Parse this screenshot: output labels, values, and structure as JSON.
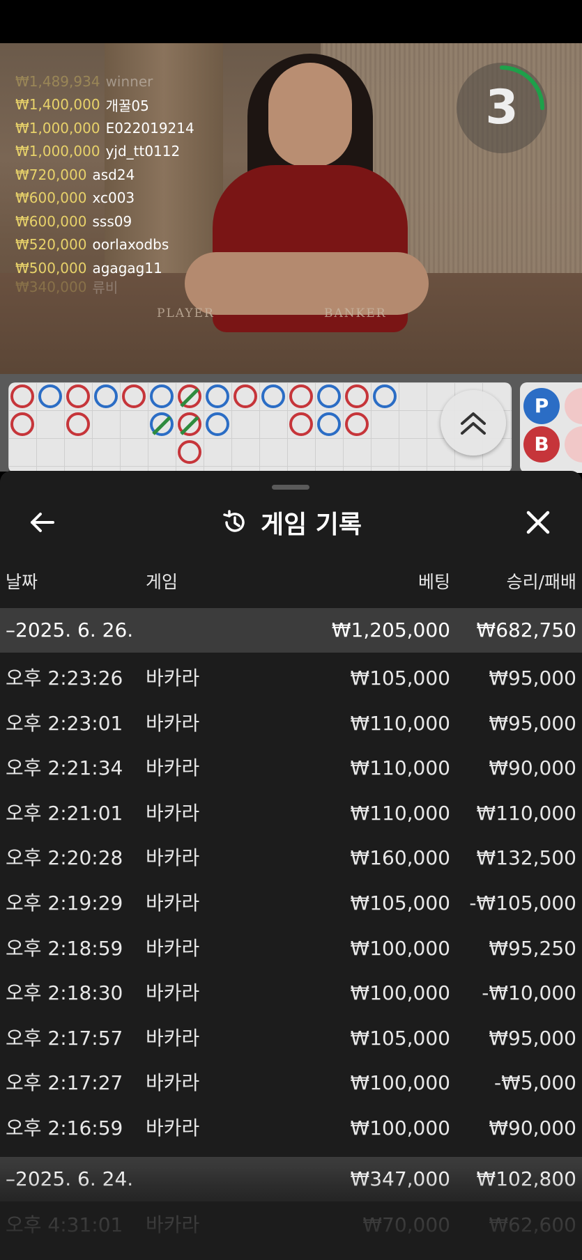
{
  "winners": [
    {
      "amount": "₩1,489,934",
      "name": "winner"
    },
    {
      "amount": "₩1,400,000",
      "name": "개꿀05"
    },
    {
      "amount": "₩1,000,000",
      "name": "E022019214"
    },
    {
      "amount": "₩1,000,000",
      "name": "yjd_tt0112"
    },
    {
      "amount": "₩720,000",
      "name": "asd24"
    },
    {
      "amount": "₩600,000",
      "name": "xc003"
    },
    {
      "amount": "₩600,000",
      "name": "sss09"
    },
    {
      "amount": "₩520,000",
      "name": "oorlaxodbs"
    },
    {
      "amount": "₩500,000",
      "name": "agagag11"
    },
    {
      "amount": "₩340,000",
      "name": "류비"
    }
  ],
  "table_labels": {
    "player": "PLAYER",
    "banker": "BANKER"
  },
  "timer": {
    "value": "3",
    "progress": 0.25
  },
  "road_buttons": {
    "player": "P",
    "banker": "B"
  },
  "colors": {
    "player": "#2b6dc5",
    "banker": "#c6353a",
    "tie": "#2e8b3e",
    "gold": "#e8d26a"
  },
  "sheet": {
    "title": "게임 기록",
    "back_icon": "arrow-left-icon",
    "history_icon": "history-clock-icon",
    "close_icon": "close-icon",
    "columns": {
      "date": "날짜",
      "game": "게임",
      "bet": "베팅",
      "win": "승리/패배"
    },
    "groups": [
      {
        "date": "–2025. 6. 26.",
        "bet": "₩1,205,000",
        "win": "₩682,750",
        "rows": [
          {
            "time": "오후 2:23:26",
            "game": "바카라",
            "bet": "₩105,000",
            "win": "₩95,000"
          },
          {
            "time": "오후 2:23:01",
            "game": "바카라",
            "bet": "₩110,000",
            "win": "₩95,000"
          },
          {
            "time": "오후 2:21:34",
            "game": "바카라",
            "bet": "₩110,000",
            "win": "₩90,000"
          },
          {
            "time": "오후 2:21:01",
            "game": "바카라",
            "bet": "₩110,000",
            "win": "₩110,000"
          },
          {
            "time": "오후 2:20:28",
            "game": "바카라",
            "bet": "₩160,000",
            "win": "₩132,500"
          },
          {
            "time": "오후 2:19:29",
            "game": "바카라",
            "bet": "₩105,000",
            "win": "-₩105,000"
          },
          {
            "time": "오후 2:18:59",
            "game": "바카라",
            "bet": "₩100,000",
            "win": "₩95,250"
          },
          {
            "time": "오후 2:18:30",
            "game": "바카라",
            "bet": "₩100,000",
            "win": "-₩10,000"
          },
          {
            "time": "오후 2:17:57",
            "game": "바카라",
            "bet": "₩105,000",
            "win": "₩95,000"
          },
          {
            "time": "오후 2:17:27",
            "game": "바카라",
            "bet": "₩100,000",
            "win": "-₩5,000"
          },
          {
            "time": "오후 2:16:59",
            "game": "바카라",
            "bet": "₩100,000",
            "win": "₩90,000"
          }
        ]
      },
      {
        "date": "–2025. 6. 24.",
        "bet": "₩347,000",
        "win": "₩102,800",
        "rows": [
          {
            "time": "오후 4:31:01",
            "game": "바카라",
            "bet": "₩70,000",
            "win": "₩62,600"
          }
        ]
      }
    ]
  }
}
